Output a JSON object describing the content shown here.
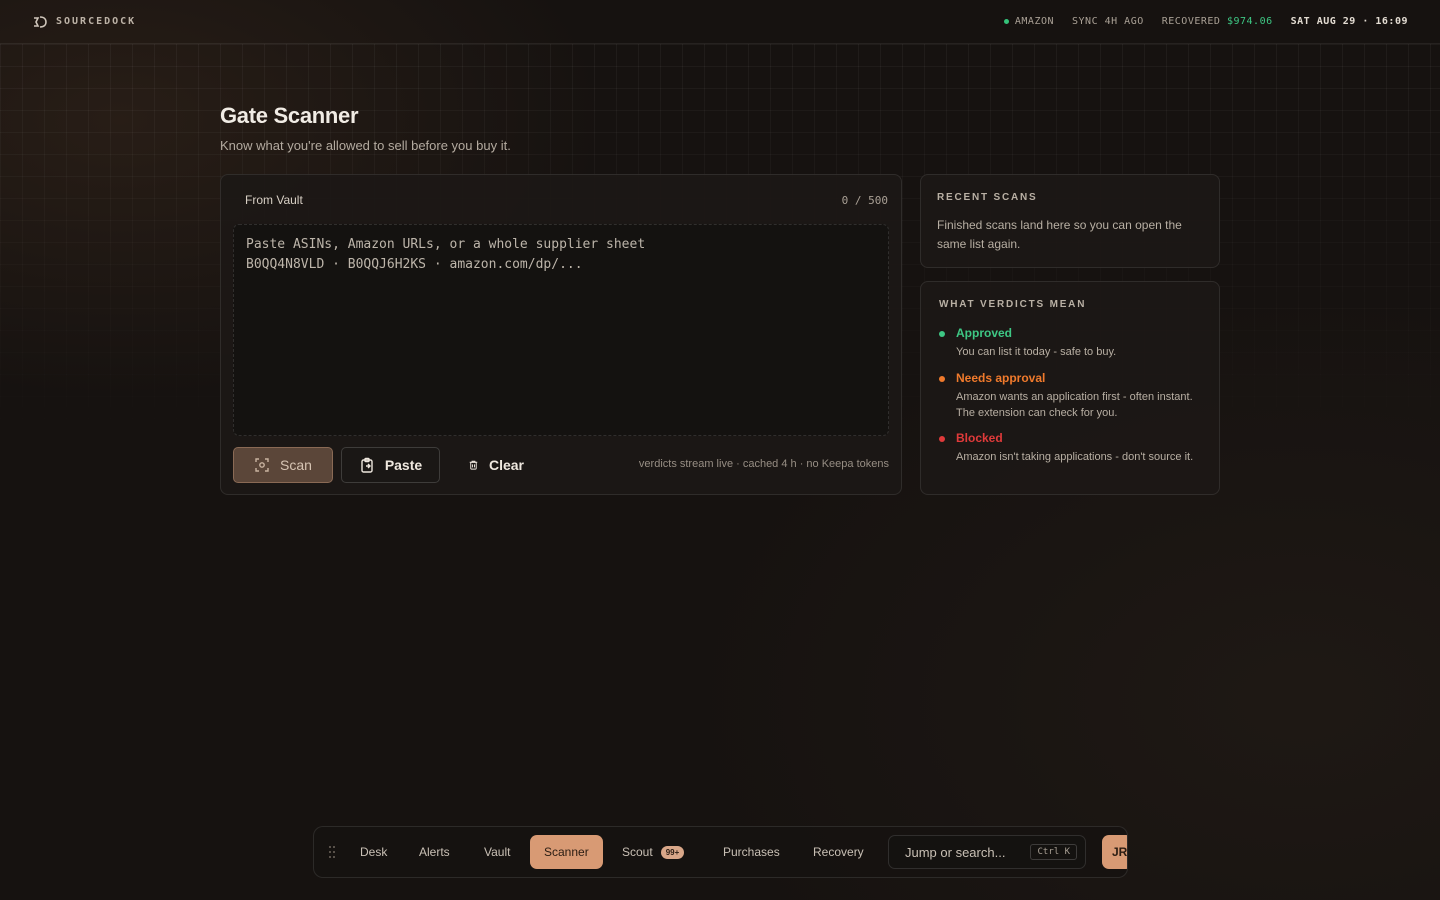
{
  "topbar": {
    "brand": "SOURCEDOCK",
    "marketplace": "AMAZON",
    "sync": "SYNC 4H AGO",
    "recovered_label": "RECOVERED",
    "recovered_value": "$974.06",
    "datetime": "SAT AUG 29 · 16:09"
  },
  "header": {
    "title": "Gate Scanner",
    "subtitle": "Know what you're allowed to sell before you buy it."
  },
  "scanner": {
    "source": "From Vault",
    "count": "0 / 500",
    "placeholder": "Paste ASINs, Amazon URLs, or a whole supplier sheet\nB0QQ4N8VLD · B0QQJ6H2KS · amazon.com/dp/...",
    "scan_label": "Scan",
    "paste_label": "Paste",
    "clear_label": "Clear",
    "hint": "verdicts stream live · cached 4 h · no Keepa tokens"
  },
  "recent": {
    "title": "RECENT SCANS",
    "text": "Finished scans land here so you can open the same list again."
  },
  "verdicts": {
    "title": "WHAT VERDICTS MEAN",
    "items": [
      {
        "label": "Approved",
        "desc": "You can list it today - safe to buy.",
        "color": "#3ec784"
      },
      {
        "label": "Needs approval",
        "desc": "Amazon wants an application first - often instant. The extension can check for you.",
        "color": "#f07a2c"
      },
      {
        "label": "Blocked",
        "desc": "Amazon isn't taking applications - don't source it.",
        "color": "#e03a3a"
      }
    ]
  },
  "dock": {
    "items": [
      {
        "label": "Desk"
      },
      {
        "label": "Alerts"
      },
      {
        "label": "Vault"
      },
      {
        "label": "Scanner",
        "active": true
      },
      {
        "label": "Scout",
        "badge": "99+"
      },
      {
        "label": "Purchases"
      },
      {
        "label": "Recovery"
      }
    ],
    "search_placeholder": "Jump or search...",
    "shortcut": "Ctrl K",
    "avatar": "JR"
  },
  "colors": {
    "accent": "#d89a74",
    "approved": "#3ec784",
    "needs_approval": "#f07a2c",
    "blocked": "#e03a3a"
  },
  "icons": [
    "logo-icon",
    "scan-icon",
    "clipboard-icon",
    "trash-icon",
    "drag-handle-icon"
  ]
}
